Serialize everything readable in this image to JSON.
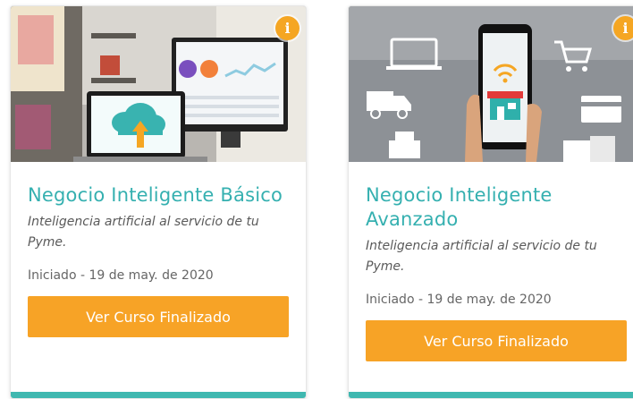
{
  "courses": [
    {
      "title": "Negocio Inteligente Básico",
      "subtitle": "Inteligencia artificial al servicio de tu Pyme.",
      "status": "Iniciado - 19 de may. de 2020",
      "button_label": "Ver Curso Finalizado",
      "info_icon": "i"
    },
    {
      "title": "Negocio Inteligente Avanzado",
      "subtitle": "Inteligencia artificial al servicio de tu Pyme.",
      "status": "Iniciado - 19 de may. de 2020",
      "button_label": "Ver Curso Finalizado",
      "info_icon": "i"
    }
  ],
  "colors": {
    "accent_orange": "#f7a326",
    "title_teal": "#35b0b0",
    "footer_teal": "#3fb8b0"
  }
}
